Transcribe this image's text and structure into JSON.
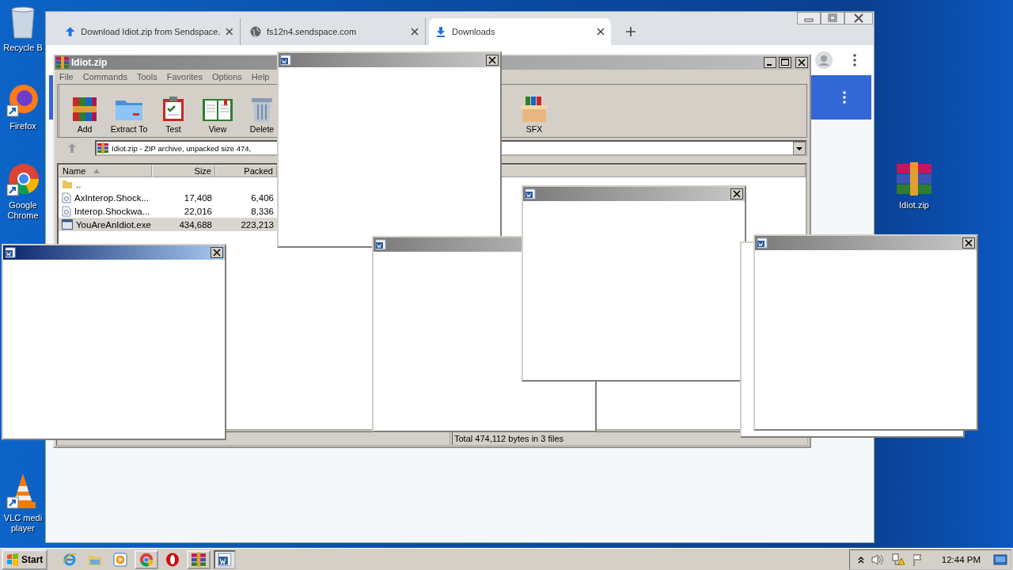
{
  "desktop_icons": [
    {
      "kind": "recycle",
      "label": "Recycle B"
    },
    {
      "kind": "firefox",
      "label": "Firefox"
    },
    {
      "kind": "chrome",
      "label": "Google\nChrome"
    },
    {
      "kind": "vlc",
      "label": "VLC medi\nplayer"
    },
    {
      "kind": "archive",
      "label": "Idiot.zip"
    }
  ],
  "browser": {
    "tabs": [
      {
        "kind": "upload",
        "title": "Download Idiot.zip from Sendspace.",
        "selected": false
      },
      {
        "kind": "globe",
        "title": "fs12n4.sendspace.com",
        "selected": false
      },
      {
        "kind": "download",
        "title": "Downloads",
        "selected": true
      }
    ]
  },
  "archiver": {
    "title": "Idiot.zip",
    "menu": [
      "File",
      "Commands",
      "Tools",
      "Favorites",
      "Options",
      "Help"
    ],
    "toolbar": [
      {
        "kind": "add",
        "label": "Add"
      },
      {
        "kind": "extract",
        "label": "Extract To"
      },
      {
        "kind": "test",
        "label": "Test"
      },
      {
        "kind": "view",
        "label": "View"
      },
      {
        "kind": "delete",
        "label": "Delete"
      },
      {
        "kind": "sfx",
        "label": "SFX"
      }
    ],
    "address": "Idiot.zip - ZIP archive, unpacked size 474,",
    "columns": [
      "Name",
      "Size",
      "Packed"
    ],
    "rows": [
      {
        "kind": "folder",
        "name": "..",
        "selected": false
      },
      {
        "kind": "file",
        "name": "AxInterop.Shock...",
        "size": "17,408",
        "packed": "6,406",
        "selected": false
      },
      {
        "kind": "file",
        "name": "Interop.Shockwa...",
        "size": "22,016",
        "packed": "8,336",
        "selected": false
      },
      {
        "kind": "exe",
        "name": "YouAreAnIdiot.exe",
        "size": "434,688",
        "packed": "223,213",
        "selected": true
      }
    ],
    "status": "Total 474,112 bytes in 3 files"
  },
  "popups": [
    {
      "kind": "window",
      "active": false
    },
    {
      "kind": "window",
      "active": true
    },
    {
      "kind": "window",
      "active": false
    },
    {
      "kind": "window",
      "active": false
    },
    {
      "kind": "frame"
    },
    {
      "kind": "window",
      "active": false
    }
  ],
  "taskbar": {
    "start": "Start",
    "apps": [
      {
        "kind": "ie",
        "running": false,
        "selected": false
      },
      {
        "kind": "explorer",
        "running": false,
        "selected": false
      },
      {
        "kind": "media",
        "running": false,
        "selected": false
      },
      {
        "kind": "chrome",
        "running": true,
        "selected": false
      },
      {
        "kind": "opera",
        "running": false,
        "selected": false
      },
      {
        "kind": "archive",
        "running": true,
        "selected": false
      },
      {
        "kind": "word",
        "running": true,
        "selected": true
      }
    ],
    "clock": "12:44 PM"
  }
}
